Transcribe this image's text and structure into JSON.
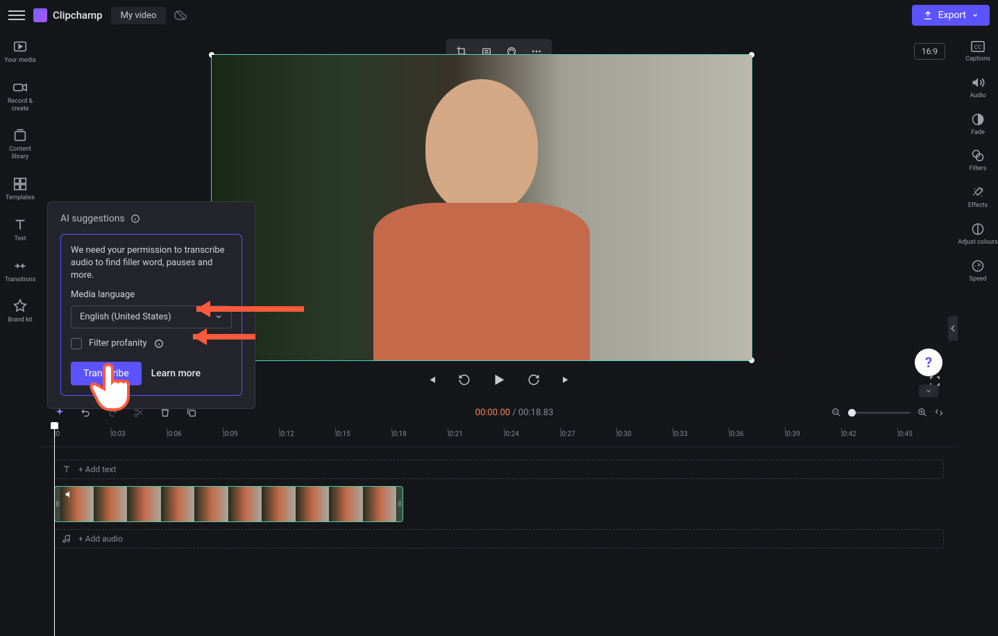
{
  "header": {
    "brand": "Clipchamp",
    "project": "My video",
    "export": "Export"
  },
  "aspect_ratio": "16:9",
  "left_sidebar": [
    {
      "label": "Your media"
    },
    {
      "label": "Record & create"
    },
    {
      "label": "Content library"
    },
    {
      "label": "Templates"
    },
    {
      "label": "Text"
    },
    {
      "label": "Transitions"
    },
    {
      "label": "Brand kit"
    }
  ],
  "right_sidebar": [
    {
      "label": "Captions"
    },
    {
      "label": "Audio"
    },
    {
      "label": "Fade"
    },
    {
      "label": "Filters"
    },
    {
      "label": "Effects"
    },
    {
      "label": "Adjust colours"
    },
    {
      "label": "Speed"
    }
  ],
  "ai_panel": {
    "title": "AI suggestions",
    "desc": "We need your permission to transcribe audio to find filler word, pauses and more.",
    "lang_label": "Media language",
    "lang_value": "English (United States)",
    "filter_label": "Filter profanity",
    "transcribe": "Transcribe",
    "learn_more": "Learn more"
  },
  "time": {
    "current": "00:00.00",
    "separator": " / ",
    "total": "00:18.83"
  },
  "ruler": [
    "0",
    "0:03",
    "0:06",
    "0:09",
    "0:12",
    "0:15",
    "0:18",
    "0:21",
    "0:24",
    "0:27",
    "0:30",
    "0:33",
    "0:36",
    "0:39",
    "0:42",
    "0:45"
  ],
  "tracks": {
    "text": "+ Add text",
    "audio": "+ Add audio"
  },
  "help": "?"
}
